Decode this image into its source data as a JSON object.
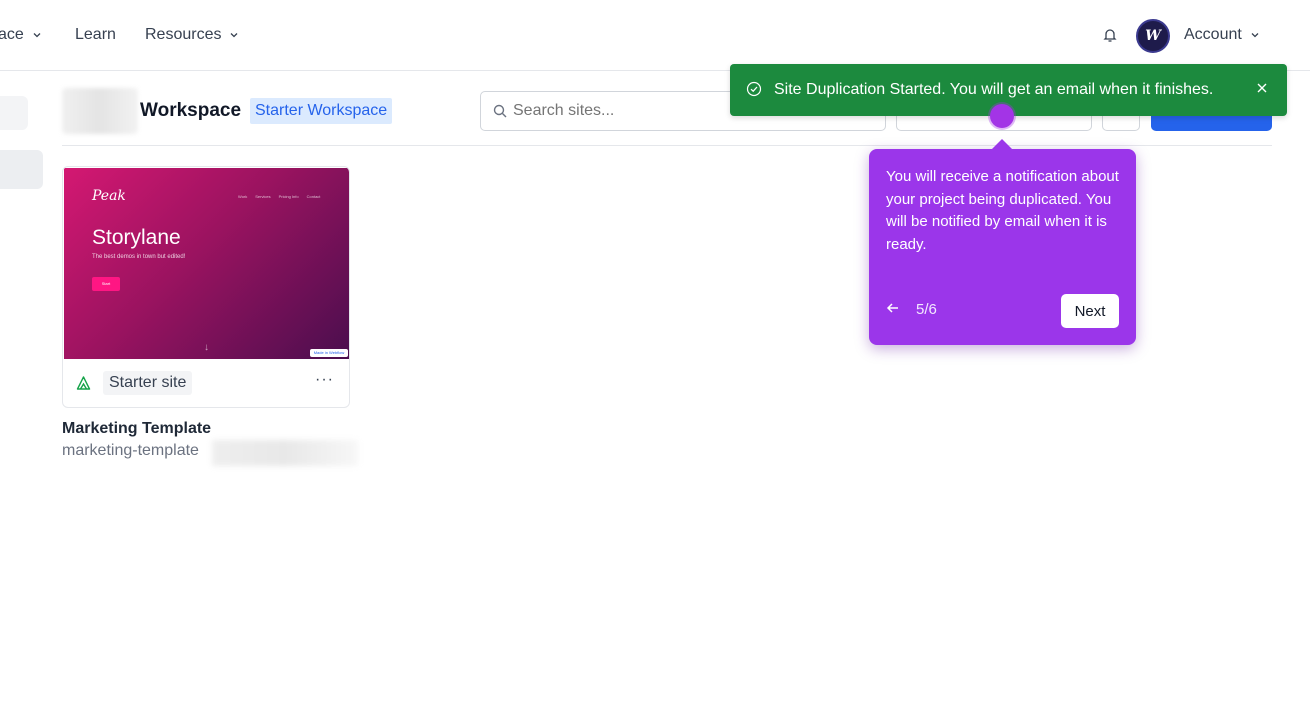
{
  "nav": {
    "workspace_label": "ace",
    "learn_label": "Learn",
    "resources_label": "Resources",
    "account_label": "Account",
    "avatar_initial": "W"
  },
  "header": {
    "workspace_title": "Workspace",
    "workspace_badge": "Starter Workspace",
    "search_placeholder": "Search sites..."
  },
  "sites": [
    {
      "thumbnail": {
        "logo": "Peak",
        "menu": [
          "Work",
          "Services",
          "Pricing Info",
          "Contact"
        ],
        "hero": "Storylane",
        "subtitle": "The best demos in town but edited!",
        "cta": "Start",
        "badge": "Made in Webflow"
      },
      "plan": "Starter site",
      "more": "···",
      "name": "Marketing Template",
      "slug": "marketing-template"
    }
  ],
  "toast": {
    "message": "Site Duplication Started. You will get an email when it finishes.",
    "color": "#1c8a3e"
  },
  "tour": {
    "text": "You will receive a notification about your project being duplicated. You will be notified by email when it is ready.",
    "step": "5/6",
    "next_label": "Next",
    "color": "#9b36ea"
  }
}
